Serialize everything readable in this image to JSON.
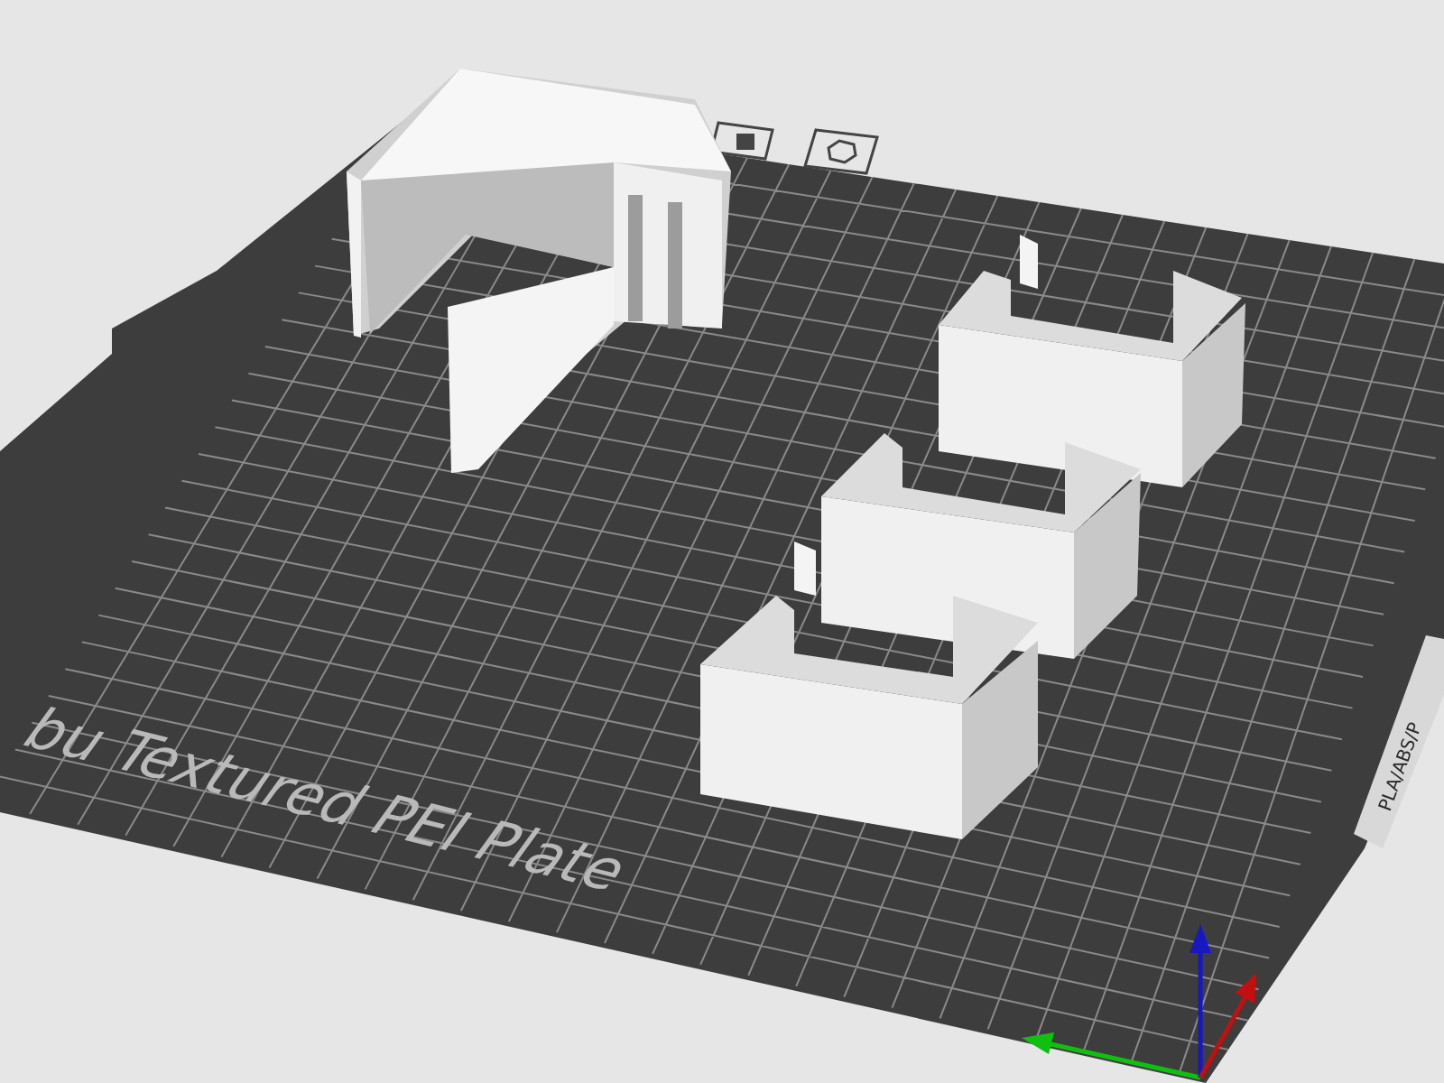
{
  "plate": {
    "label": "bu Textured PEI Plate",
    "side_label": "PLA/ABS/P"
  }
}
